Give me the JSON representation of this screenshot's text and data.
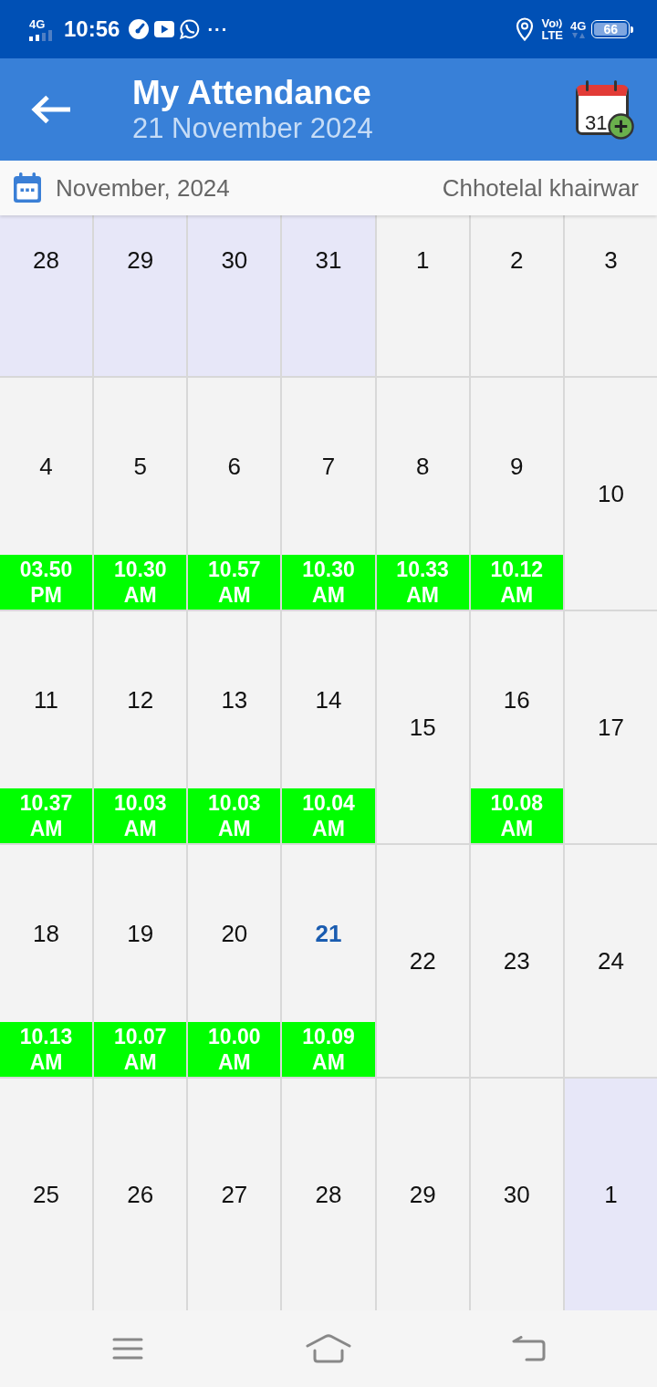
{
  "status_bar": {
    "network_type": "4G",
    "time": "10:56",
    "more": "···",
    "volte_top": "Vo",
    "volte_bottom": "LTE",
    "network_type_right": "4G",
    "battery": "66"
  },
  "app_bar": {
    "title": "My Attendance",
    "subtitle": "21 November 2024",
    "calendar_icon_day": "31"
  },
  "month_bar": {
    "month": "November, 2024",
    "employee": "Chhotelal khairwar"
  },
  "calendar": {
    "weeks": [
      {
        "days": [
          {
            "day": "28",
            "in_month": false,
            "today": false
          },
          {
            "day": "29",
            "in_month": false,
            "today": false
          },
          {
            "day": "30",
            "in_month": false,
            "today": false
          },
          {
            "day": "31",
            "in_month": false,
            "today": false
          },
          {
            "day": "1",
            "in_month": true,
            "today": false
          },
          {
            "day": "2",
            "in_month": true,
            "today": false
          },
          {
            "day": "3",
            "in_month": true,
            "today": false
          }
        ]
      },
      {
        "days": [
          {
            "day": "4",
            "in_month": true,
            "today": false,
            "check_in": "03.50 PM"
          },
          {
            "day": "5",
            "in_month": true,
            "today": false,
            "check_in": "10.30 AM"
          },
          {
            "day": "6",
            "in_month": true,
            "today": false,
            "check_in": "10.57 AM"
          },
          {
            "day": "7",
            "in_month": true,
            "today": false,
            "check_in": "10.30 AM"
          },
          {
            "day": "8",
            "in_month": true,
            "today": false,
            "check_in": "10.33 AM"
          },
          {
            "day": "9",
            "in_month": true,
            "today": false,
            "check_in": "10.12 AM"
          },
          {
            "day": "10",
            "in_month": true,
            "today": false
          }
        ]
      },
      {
        "days": [
          {
            "day": "11",
            "in_month": true,
            "today": false,
            "check_in": "10.37 AM"
          },
          {
            "day": "12",
            "in_month": true,
            "today": false,
            "check_in": "10.03 AM"
          },
          {
            "day": "13",
            "in_month": true,
            "today": false,
            "check_in": "10.03 AM"
          },
          {
            "day": "14",
            "in_month": true,
            "today": false,
            "check_in": "10.04 AM"
          },
          {
            "day": "15",
            "in_month": true,
            "today": false
          },
          {
            "day": "16",
            "in_month": true,
            "today": false,
            "check_in": "10.08 AM"
          },
          {
            "day": "17",
            "in_month": true,
            "today": false
          }
        ]
      },
      {
        "days": [
          {
            "day": "18",
            "in_month": true,
            "today": false,
            "check_in": "10.13 AM"
          },
          {
            "day": "19",
            "in_month": true,
            "today": false,
            "check_in": "10.07 AM"
          },
          {
            "day": "20",
            "in_month": true,
            "today": false,
            "check_in": "10.00 AM"
          },
          {
            "day": "21",
            "in_month": true,
            "today": true,
            "check_in": "10.09 AM"
          },
          {
            "day": "22",
            "in_month": true,
            "today": false
          },
          {
            "day": "23",
            "in_month": true,
            "today": false
          },
          {
            "day": "24",
            "in_month": true,
            "today": false
          }
        ]
      },
      {
        "days": [
          {
            "day": "25",
            "in_month": true,
            "today": false
          },
          {
            "day": "26",
            "in_month": true,
            "today": false
          },
          {
            "day": "27",
            "in_month": true,
            "today": false
          },
          {
            "day": "28",
            "in_month": true,
            "today": false
          },
          {
            "day": "29",
            "in_month": true,
            "today": false
          },
          {
            "day": "30",
            "in_month": true,
            "today": false
          },
          {
            "day": "1",
            "in_month": false,
            "today": false
          }
        ]
      }
    ]
  }
}
